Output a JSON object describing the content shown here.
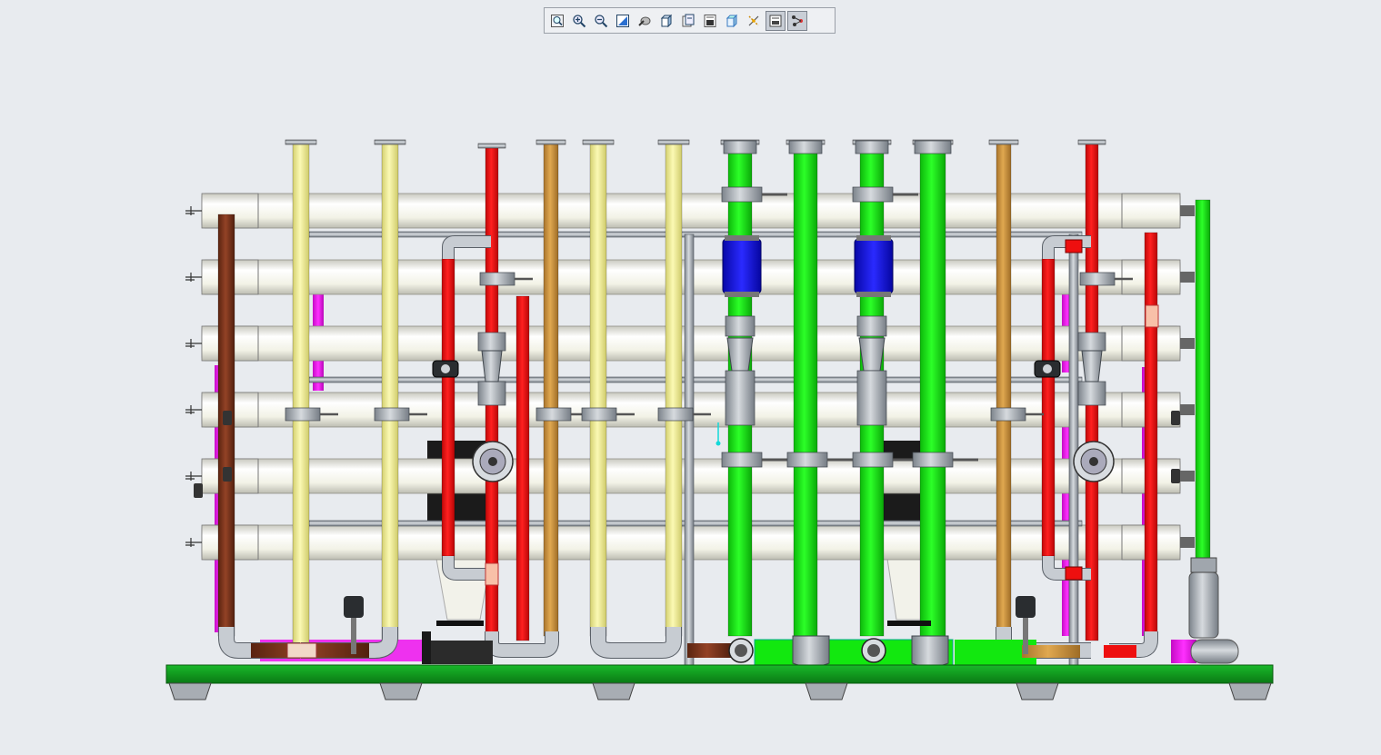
{
  "toolbar": {
    "tools": [
      {
        "name": "zoom-to-fit-icon",
        "pressed": false
      },
      {
        "name": "zoom-in-icon",
        "pressed": false
      },
      {
        "name": "zoom-out-icon",
        "pressed": false
      },
      {
        "name": "repaint-icon",
        "pressed": false
      },
      {
        "name": "display-style-icon",
        "pressed": false
      },
      {
        "name": "view-cube-icon",
        "pressed": false
      },
      {
        "name": "saved-views-icon",
        "pressed": false
      },
      {
        "name": "layer-manager-icon",
        "pressed": false
      },
      {
        "name": "spin-center-icon",
        "pressed": false
      },
      {
        "name": "datum-display-icon",
        "pressed": false
      },
      {
        "name": "annotation-display-icon",
        "pressed": true
      },
      {
        "name": "model-tree-icon",
        "pressed": true
      }
    ]
  },
  "colors": {
    "background": "#e8ebef",
    "base_frame": "#119b1f",
    "membrane_vessel": "#f4f4e6",
    "feed_pipe": "#f5f39a",
    "concentrate_pipe": "#ee0f0f",
    "permeate_pipe": "#12e80f",
    "brine_pipe": "#cf9640",
    "drain_pipe": "#7a3419",
    "magenta_pipe": "#ee11ee",
    "valve_blue": "#1616f5",
    "fitting_grey": "#a5acb4"
  }
}
